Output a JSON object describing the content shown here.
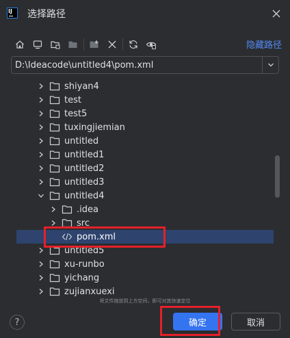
{
  "dialog": {
    "title": "选择路径",
    "hide_path_label": "隐藏路径",
    "path_value": "D:\\Ideacode\\untitled4\\pom.xml",
    "hint": "将文件拖放到上方空间，即可对其快速定位",
    "help_label": "?",
    "ok_label": "确定",
    "cancel_label": "取消"
  },
  "toolbar": {
    "icons": [
      "home-icon",
      "desktop-icon",
      "project-icon",
      "module-icon",
      "new-folder-icon",
      "delete-icon",
      "refresh-icon",
      "show-hidden-icon"
    ]
  },
  "tree": {
    "items": [
      {
        "label": "shiyan4",
        "expanded": false,
        "level": 1
      },
      {
        "label": "test",
        "expanded": false,
        "level": 1
      },
      {
        "label": "test5",
        "expanded": false,
        "level": 1
      },
      {
        "label": "tuxingjiemian",
        "expanded": false,
        "level": 1
      },
      {
        "label": "untitled",
        "expanded": false,
        "level": 1
      },
      {
        "label": "untitled1",
        "expanded": false,
        "level": 1
      },
      {
        "label": "untitled2",
        "expanded": false,
        "level": 1
      },
      {
        "label": "untitled3",
        "expanded": false,
        "level": 1
      },
      {
        "label": "untitled4",
        "expanded": true,
        "level": 1
      },
      {
        "label": ".idea",
        "expanded": false,
        "level": 2
      },
      {
        "label": "src",
        "expanded": false,
        "level": 2
      },
      {
        "label": "pom.xml",
        "type": "file",
        "selected": true,
        "level": 2
      },
      {
        "label": "untitled5",
        "expanded": false,
        "level": 1
      },
      {
        "label": "xu-runbo",
        "expanded": false,
        "level": 1
      },
      {
        "label": "yichang",
        "expanded": false,
        "level": 1
      },
      {
        "label": "zujianxuexi",
        "expanded": false,
        "level": 1
      }
    ]
  },
  "colors": {
    "background": "#2b2d30",
    "accent": "#3574f0",
    "selection": "#2e436e",
    "link": "#548af7",
    "highlight_box": "#e5202a"
  }
}
